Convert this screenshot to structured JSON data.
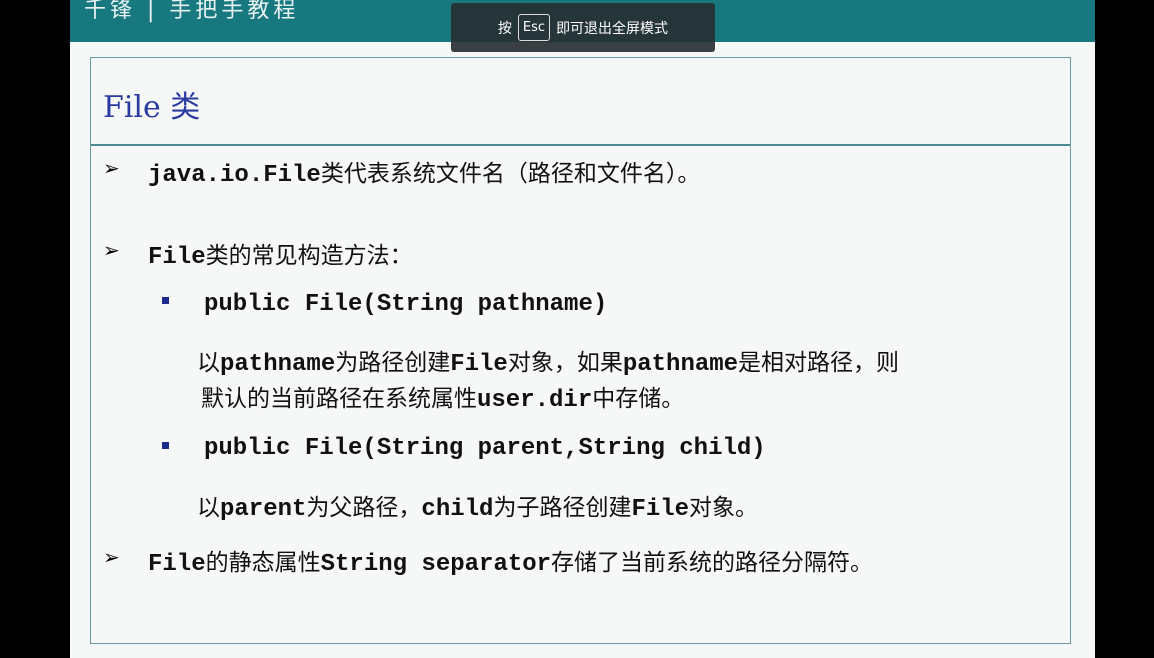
{
  "header": {
    "logo": "千锋 | 手把手教程"
  },
  "toast": {
    "pre": "按",
    "key": "Esc",
    "post": "即可退出全屏模式"
  },
  "slide": {
    "title": "File 类",
    "b1": {
      "code": "java.io.File",
      "text": "类代表系统文件名（路径和文件名）。"
    },
    "b2": {
      "code": "File",
      "text": "类的常见构造方法："
    },
    "c1": {
      "sig": "public File(String pathname)",
      "d1a": "以",
      "d1b": "pathname",
      "d1c": "为路径创建",
      "d1d": "File",
      "d1e": "对象，如果",
      "d1f": "pathname",
      "d1g": "是相对路径，则",
      "d2a": "默认的当前路径在系统属性",
      "d2b": "user.dir",
      "d2c": "中存储。"
    },
    "c2": {
      "sig": "public File(String parent,String child)",
      "da": "以",
      "db": "parent",
      "dc": "为父路径，",
      "dd": "child",
      "de": "为子路径创建",
      "df": "File",
      "dg": "对象。"
    },
    "b3": {
      "a": "File",
      "b": "的静态属性",
      "c": "String separator",
      "d": "存储了当前系统的路径分隔符。"
    }
  }
}
